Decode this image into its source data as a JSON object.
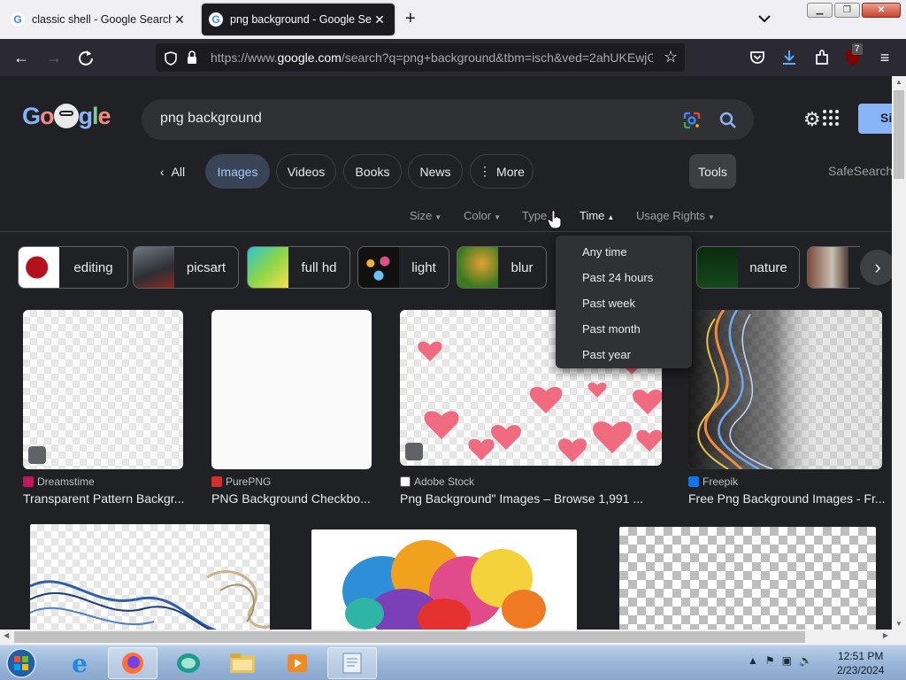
{
  "browser": {
    "tabs": [
      {
        "title": "classic shell - Google Search",
        "close": "✕"
      },
      {
        "title": "png background - Google Search",
        "close": "✕"
      }
    ],
    "new_tab": "+",
    "url_prefix": "https://www.",
    "url_domain": "google.com",
    "url_rest": "/search?q=png+background&tbm=isch&ved=2ahUKEwjG",
    "extension_badge": "7"
  },
  "google": {
    "logo": "Google",
    "query": "png background",
    "signin_label": "Si",
    "nav": {
      "all": "All",
      "images": "Images",
      "videos": "Videos",
      "books": "Books",
      "news": "News",
      "more": "More",
      "tools": "Tools",
      "safesearch": "SafeSearch"
    },
    "filters": [
      "Size",
      "Color",
      "Type",
      "Time",
      "Usage Rights"
    ],
    "time_menu": [
      "Any time",
      "Past 24 hours",
      "Past week",
      "Past month",
      "Past year"
    ],
    "related": [
      "editing",
      "picsart",
      "full hd",
      "light",
      "blur",
      "nature"
    ],
    "results": [
      {
        "source": "Dreamstime",
        "title": "Transparent Pattern Backgr..."
      },
      {
        "source": "PurePNG",
        "title": "PNG Background Checkbo..."
      },
      {
        "source": "Adobe Stock",
        "title": "Png Background\" Images – Browse 1,991 ..."
      },
      {
        "source": "Freepik",
        "title": "Free Png Background Images - Fr..."
      }
    ]
  },
  "taskbar": {
    "time": "12:51 PM",
    "date": "2/23/2024"
  },
  "colors": {
    "page_bg": "#202124",
    "accent": "#8ab4f8",
    "selected_chip": "#394457"
  }
}
